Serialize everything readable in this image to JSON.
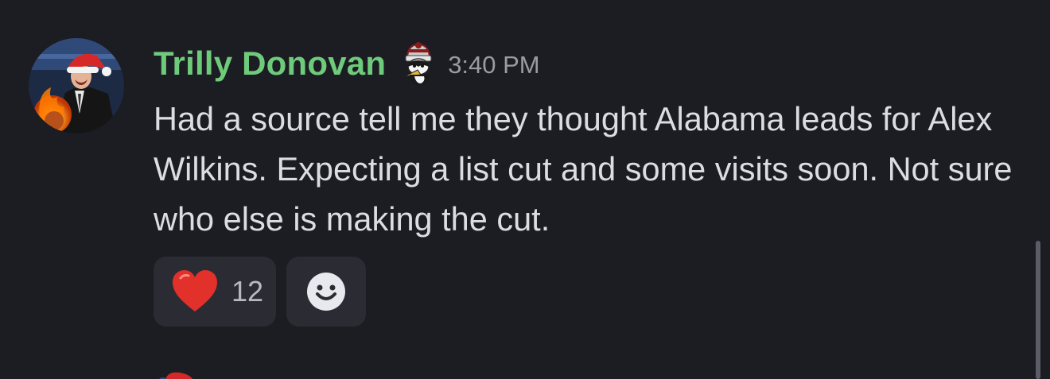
{
  "message": {
    "author": "Trilly Donovan",
    "timestamp": "3:40 PM",
    "text": "Had a source tell me they thought Alabama leads for Alex Wilkins. Expecting a list cut and some visits soon. Not sure who else is making the cut.",
    "author_color": "#6ecb7b"
  },
  "reactions": [
    {
      "emoji": "heart",
      "count": "12"
    },
    {
      "emoji": "add-reaction"
    }
  ],
  "colors": {
    "background": "#1c1d22",
    "reaction_bg": "#2b2c33",
    "heart": "#e53935"
  }
}
